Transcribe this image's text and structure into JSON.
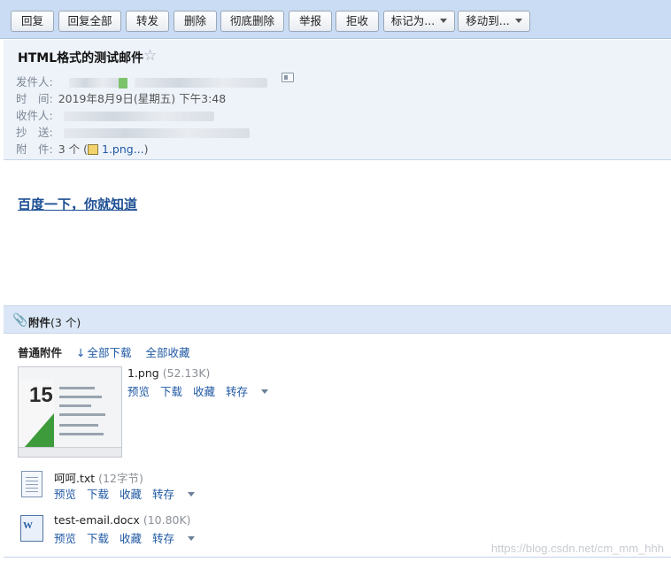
{
  "toolbar": {
    "reply": "回复",
    "reply_all": "回复全部",
    "forward": "转发",
    "delete": "删除",
    "delete_permanently": "彻底删除",
    "report": "举报",
    "reject": "拒收",
    "mark_as": "标记为...",
    "move_to": "移动到..."
  },
  "mail": {
    "subject": "HTML格式的测试邮件",
    "star_glyph": "☆",
    "from_label": "发件人:",
    "time_label": "时　间:",
    "time_value": "2019年8月9日(星期五) 下午3:48",
    "to_label": "收件人:",
    "cc_label": "抄　送:",
    "attach_label": "附　件:",
    "attach_count": "3 个",
    "attach_preview_name": "1.png...",
    "body_link": "百度一下，你就知道"
  },
  "attachments": {
    "panel_title": "附件",
    "panel_count": "(3 个)",
    "tab_normal": "普通附件",
    "download_all": "全部下载",
    "collect_all": "全部收藏",
    "action_preview": "预览",
    "action_download": "下载",
    "action_collect": "收藏",
    "action_save": "转存",
    "items": [
      {
        "name": "1.png",
        "size": "(52.13K)",
        "icon": "image-thumbnail"
      },
      {
        "name": "呵呵.txt",
        "size": "(12字节)",
        "icon": "text-file-icon"
      },
      {
        "name": "test-email.docx",
        "size": "(10.80K)",
        "icon": "word-file-icon"
      }
    ]
  },
  "thumbnail": {
    "number": "15"
  },
  "watermark": "https://blog.csdn.net/cm_mm_hhh"
}
